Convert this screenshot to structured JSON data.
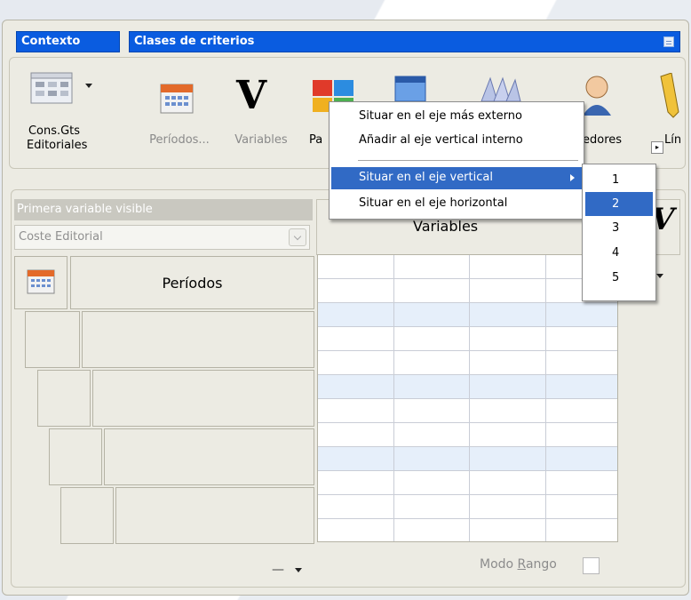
{
  "context": {
    "label": "Contexto",
    "value": "Clases de criterios"
  },
  "toolbar": {
    "items": [
      {
        "label": "Cons.Gts Editoriales",
        "icon": "report-table-icon",
        "enabled": true
      },
      {
        "label": "Períodos...",
        "icon": "calendar-grid-icon",
        "enabled": false
      },
      {
        "label": "Variables",
        "icon": "letter-v-icon",
        "enabled": false
      },
      {
        "label": "Pa",
        "icon": "color-blocks-icon",
        "enabled": true
      },
      {
        "label": "",
        "icon": "window-screen-icon",
        "enabled": true
      },
      {
        "label": "",
        "icon": "books-icon",
        "enabled": true
      },
      {
        "label": "edores",
        "icon": "person-icon",
        "enabled": true
      },
      {
        "label": "Lín",
        "icon": "pencil-icon",
        "enabled": true
      }
    ]
  },
  "left_panel": {
    "header": "Primera variable visible",
    "combo_value": "Coste Editorial",
    "periodos_label": "Períodos"
  },
  "variables_header": "Variables",
  "bottom": {
    "dash": "—",
    "modo_rango_prefix": "Modo ",
    "modo_rango_accel": "R",
    "modo_rango_suffix": "ango"
  },
  "context_menu": {
    "items": [
      {
        "label": "Situar en el eje más externo"
      },
      {
        "label": "Añadir al eje vertical interno"
      },
      {
        "label": "Situar en el eje vertical",
        "highlighted": true,
        "submenu": true
      },
      {
        "label": "Situar en el eje horizontal"
      }
    ]
  },
  "submenu": {
    "items": [
      "1",
      "2",
      "3",
      "4",
      "5"
    ],
    "highlighted_index": 1
  },
  "colors": {
    "header_blue": "#0a5ce0",
    "highlight": "#316ac5",
    "panel_bg": "#ecebe3"
  }
}
